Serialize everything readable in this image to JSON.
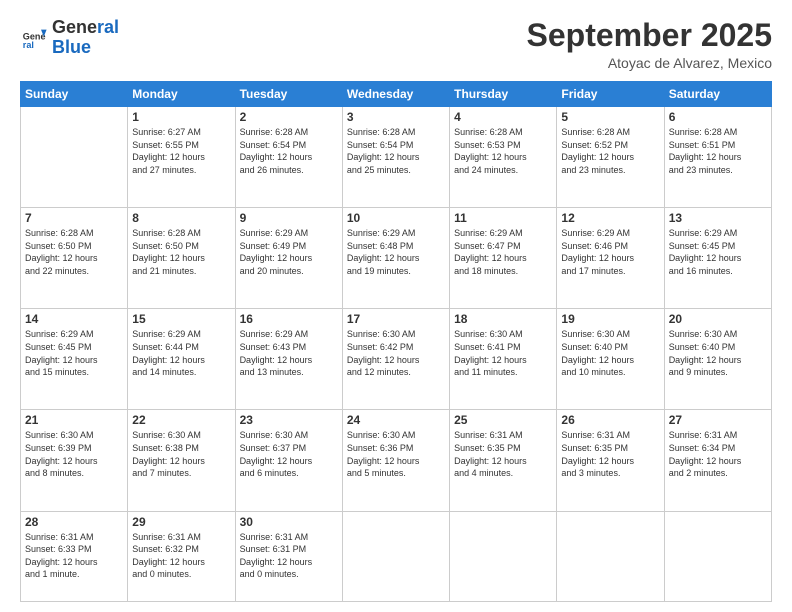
{
  "header": {
    "logo_general": "General",
    "logo_blue": "Blue",
    "month_title": "September 2025",
    "location": "Atoyac de Alvarez, Mexico"
  },
  "weekdays": [
    "Sunday",
    "Monday",
    "Tuesday",
    "Wednesday",
    "Thursday",
    "Friday",
    "Saturday"
  ],
  "weeks": [
    [
      {
        "day": "",
        "info": ""
      },
      {
        "day": "1",
        "info": "Sunrise: 6:27 AM\nSunset: 6:55 PM\nDaylight: 12 hours\nand 27 minutes."
      },
      {
        "day": "2",
        "info": "Sunrise: 6:28 AM\nSunset: 6:54 PM\nDaylight: 12 hours\nand 26 minutes."
      },
      {
        "day": "3",
        "info": "Sunrise: 6:28 AM\nSunset: 6:54 PM\nDaylight: 12 hours\nand 25 minutes."
      },
      {
        "day": "4",
        "info": "Sunrise: 6:28 AM\nSunset: 6:53 PM\nDaylight: 12 hours\nand 24 minutes."
      },
      {
        "day": "5",
        "info": "Sunrise: 6:28 AM\nSunset: 6:52 PM\nDaylight: 12 hours\nand 23 minutes."
      },
      {
        "day": "6",
        "info": "Sunrise: 6:28 AM\nSunset: 6:51 PM\nDaylight: 12 hours\nand 23 minutes."
      }
    ],
    [
      {
        "day": "7",
        "info": "Sunrise: 6:28 AM\nSunset: 6:50 PM\nDaylight: 12 hours\nand 22 minutes."
      },
      {
        "day": "8",
        "info": "Sunrise: 6:28 AM\nSunset: 6:50 PM\nDaylight: 12 hours\nand 21 minutes."
      },
      {
        "day": "9",
        "info": "Sunrise: 6:29 AM\nSunset: 6:49 PM\nDaylight: 12 hours\nand 20 minutes."
      },
      {
        "day": "10",
        "info": "Sunrise: 6:29 AM\nSunset: 6:48 PM\nDaylight: 12 hours\nand 19 minutes."
      },
      {
        "day": "11",
        "info": "Sunrise: 6:29 AM\nSunset: 6:47 PM\nDaylight: 12 hours\nand 18 minutes."
      },
      {
        "day": "12",
        "info": "Sunrise: 6:29 AM\nSunset: 6:46 PM\nDaylight: 12 hours\nand 17 minutes."
      },
      {
        "day": "13",
        "info": "Sunrise: 6:29 AM\nSunset: 6:45 PM\nDaylight: 12 hours\nand 16 minutes."
      }
    ],
    [
      {
        "day": "14",
        "info": "Sunrise: 6:29 AM\nSunset: 6:45 PM\nDaylight: 12 hours\nand 15 minutes."
      },
      {
        "day": "15",
        "info": "Sunrise: 6:29 AM\nSunset: 6:44 PM\nDaylight: 12 hours\nand 14 minutes."
      },
      {
        "day": "16",
        "info": "Sunrise: 6:29 AM\nSunset: 6:43 PM\nDaylight: 12 hours\nand 13 minutes."
      },
      {
        "day": "17",
        "info": "Sunrise: 6:30 AM\nSunset: 6:42 PM\nDaylight: 12 hours\nand 12 minutes."
      },
      {
        "day": "18",
        "info": "Sunrise: 6:30 AM\nSunset: 6:41 PM\nDaylight: 12 hours\nand 11 minutes."
      },
      {
        "day": "19",
        "info": "Sunrise: 6:30 AM\nSunset: 6:40 PM\nDaylight: 12 hours\nand 10 minutes."
      },
      {
        "day": "20",
        "info": "Sunrise: 6:30 AM\nSunset: 6:40 PM\nDaylight: 12 hours\nand 9 minutes."
      }
    ],
    [
      {
        "day": "21",
        "info": "Sunrise: 6:30 AM\nSunset: 6:39 PM\nDaylight: 12 hours\nand 8 minutes."
      },
      {
        "day": "22",
        "info": "Sunrise: 6:30 AM\nSunset: 6:38 PM\nDaylight: 12 hours\nand 7 minutes."
      },
      {
        "day": "23",
        "info": "Sunrise: 6:30 AM\nSunset: 6:37 PM\nDaylight: 12 hours\nand 6 minutes."
      },
      {
        "day": "24",
        "info": "Sunrise: 6:30 AM\nSunset: 6:36 PM\nDaylight: 12 hours\nand 5 minutes."
      },
      {
        "day": "25",
        "info": "Sunrise: 6:31 AM\nSunset: 6:35 PM\nDaylight: 12 hours\nand 4 minutes."
      },
      {
        "day": "26",
        "info": "Sunrise: 6:31 AM\nSunset: 6:35 PM\nDaylight: 12 hours\nand 3 minutes."
      },
      {
        "day": "27",
        "info": "Sunrise: 6:31 AM\nSunset: 6:34 PM\nDaylight: 12 hours\nand 2 minutes."
      }
    ],
    [
      {
        "day": "28",
        "info": "Sunrise: 6:31 AM\nSunset: 6:33 PM\nDaylight: 12 hours\nand 1 minute."
      },
      {
        "day": "29",
        "info": "Sunrise: 6:31 AM\nSunset: 6:32 PM\nDaylight: 12 hours\nand 0 minutes."
      },
      {
        "day": "30",
        "info": "Sunrise: 6:31 AM\nSunset: 6:31 PM\nDaylight: 12 hours\nand 0 minutes."
      },
      {
        "day": "",
        "info": ""
      },
      {
        "day": "",
        "info": ""
      },
      {
        "day": "",
        "info": ""
      },
      {
        "day": "",
        "info": ""
      }
    ]
  ]
}
